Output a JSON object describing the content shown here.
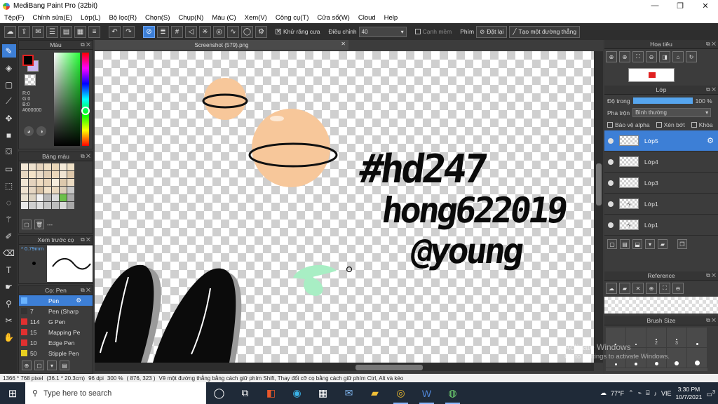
{
  "window": {
    "title": "MediBang Paint Pro (32bit)",
    "controls": [
      "—",
      "❐",
      "✕"
    ]
  },
  "menu": [
    "Tệp(F)",
    "Chỉnh sửa(E)",
    "Lớp(L)",
    "Bộ lọc(R)",
    "Chọn(S)",
    "Chụp(N)",
    "Màu (C)",
    "Xem(V)",
    "Công cụ(T)",
    "Cửa sổ(W)",
    "Cloud",
    "Help"
  ],
  "toolbar": {
    "antialias_label": "Khử răng cưa",
    "adjust_label": "Điều chỉnh",
    "adjust_value": "40",
    "edge_label": "Cạnh mềm",
    "key_label": "Phím",
    "reset_label": "Đặt lại",
    "line_label": "Tạo một đường thẳng"
  },
  "color_panel": {
    "title": "Màu",
    "r": "R:0",
    "g": "G:0",
    "b": "B:0",
    "hex": "#000000"
  },
  "swatch_panel": {
    "title": "Bảng màu",
    "foot_text": "---"
  },
  "swatch_colors": [
    "#f3e7d6",
    "#ede0cd",
    "#e6d4bd",
    "#f0dfc4",
    "#e9d6b7",
    "#f4ead9",
    "#efe1c7",
    "#e8d9c2",
    "#f3e2c8",
    "#eadbc7",
    "#e1cdb3",
    "#ebd8bc",
    "#f0e4d2",
    "#dec8aa",
    "#f2e6d4",
    "#e4d3be",
    "#efdcc1",
    "#e7d3b8",
    "#f6ecdd",
    "#ddc9ad",
    "#ecdcc3",
    "#efe2cf",
    "#e6d7c3",
    "#d8c2a5",
    "#f1e1c8",
    "#e9d8bf",
    "#ded0bb",
    "#c9c9c9",
    "#e8e0d0",
    "#dcd3c2",
    "#f4f4f4",
    "#b9b9b9",
    "#dcdcdc",
    "#6cc04a",
    "#aaaaaa",
    "#e8e8e8",
    "#cfcfcf",
    "#dddddd",
    "#c7c7c7",
    "#bdbdbd",
    "#d9d9d9",
    "#a9a9a9"
  ],
  "preview_panel": {
    "title": "Xem trước cọ",
    "size": "0.79mm"
  },
  "brush_panel": {
    "title": "Cọ: Pen",
    "items": [
      {
        "size": "",
        "name": "Pen",
        "color": "#3d7fd6"
      },
      {
        "size": "7",
        "name": "Pen (Sharp",
        "color": "#333333"
      },
      {
        "size": "114",
        "name": "G Pen",
        "color": "#e03030"
      },
      {
        "size": "15",
        "name": "Mapping Pe",
        "color": "#e03030"
      },
      {
        "size": "10",
        "name": "Edge Pen",
        "color": "#e03030"
      },
      {
        "size": "50",
        "name": "Stipple Pen",
        "color": "#e8d020"
      }
    ]
  },
  "document": {
    "tab": "Screenshot (579).png"
  },
  "canvas_text": [
    "#hd247",
    "hong622019",
    "@young"
  ],
  "navigator": {
    "title": "Hoa tiêu"
  },
  "layer_panel": {
    "title": "Lớp",
    "opacity_label": "Độ trong",
    "opacity_value": "100 %",
    "opacity": 1.0,
    "blend_label": "Pha trộn",
    "blend_value": "Bình thường",
    "protect_alpha": "Bảo vệ alpha",
    "clipping": "Xén bớt",
    "lock": "Khóa",
    "layers": [
      "Lớp5",
      "Lớp4",
      "Lớp3",
      "Lớp1",
      "Lớp1"
    ]
  },
  "reference_panel": {
    "title": "Reference"
  },
  "brushsize_panel": {
    "title": "Brush Size",
    "sizes": [
      "",
      "",
      "2",
      "3",
      "",
      "",
      "",
      "",
      "",
      ""
    ]
  },
  "watermark": {
    "line1": "Activate Windows",
    "line2": "Go to Settings to activate Windows."
  },
  "status": {
    "size": "1366 * 768 pixel",
    "cm": "(36.1 * 20.3cm)",
    "dpi": "96 dpi",
    "zoom": "300 %",
    "coords": "( 876, 323 )",
    "hint": "Vẽ một đường thẳng bằng cách giữ phím Shift, Thay đổi cỡ cọ bằng cách giữ phím Ctrl, Alt và kéo"
  },
  "taskbar": {
    "search_placeholder": "Type here to search",
    "weather": "77°F",
    "lang": "VIE",
    "time": "3:30 PM",
    "date": "10/7/2021",
    "notifications": "3"
  }
}
